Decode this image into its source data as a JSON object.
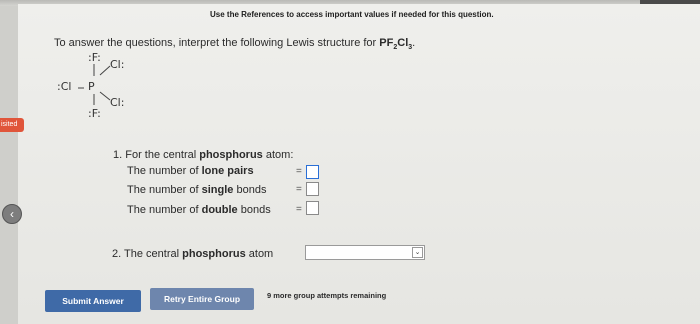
{
  "header": {
    "references_note": "Use the References to access important values if needed for this question."
  },
  "instruction": {
    "text": "To answer the questions, interpret the following Lewis structure for ",
    "formula_p": "PF",
    "sub1": "2",
    "formula_cl": "Cl",
    "sub2": "3",
    "period": "."
  },
  "lewis": {
    "f_top": ":F:",
    "cl_top": "Cl:",
    "cl_left": ":Cl",
    "p": "P",
    "cl_bottom": "Cl:",
    "f_bottom": ":F:"
  },
  "sidebar": {
    "visited_label": "isited"
  },
  "question1": {
    "number": "1.",
    "prefix": "For the central",
    "bold": "phosphorus",
    "suffix": "atom:",
    "rows": [
      {
        "pre": "The number of",
        "bold": "lone pairs",
        "eq": "="
      },
      {
        "pre": "The number of",
        "bold": "single",
        "post": "bonds",
        "eq": "="
      },
      {
        "pre": "The number of",
        "bold": "double",
        "post": "bonds",
        "eq": "="
      }
    ]
  },
  "question2": {
    "number": "2.",
    "prefix": "The central",
    "bold": "phosphorus",
    "suffix": "atom",
    "dropdown_value": ""
  },
  "buttons": {
    "submit": "Submit Answer",
    "retry": "Retry Entire Group"
  },
  "attempts": "9 more group attempts remaining",
  "colors": {
    "submit": "#3f6aa7",
    "retry": "#6e86ad",
    "visited_tab": "#e0553a"
  }
}
